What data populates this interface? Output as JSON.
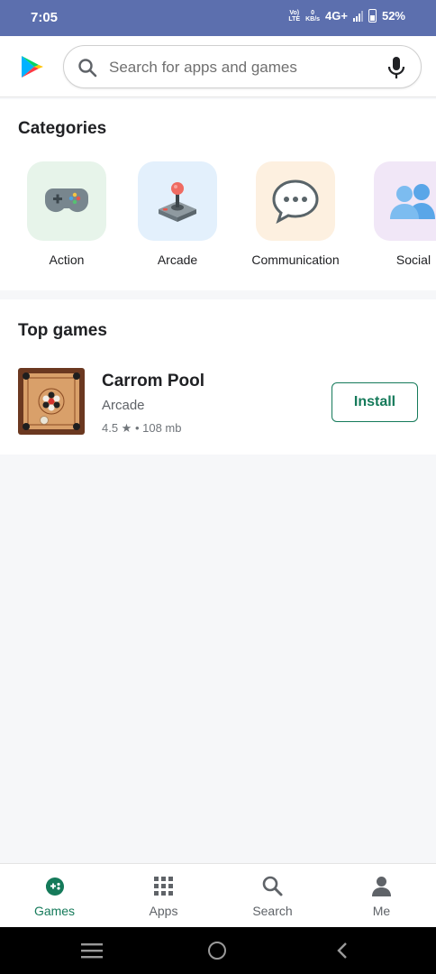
{
  "status_bar": {
    "time": "7:05",
    "volte_top": "Vo)",
    "volte_bottom": "LTE",
    "speed_value": "0",
    "speed_unit": "KB/s",
    "network": "4G+",
    "battery": "52%"
  },
  "search": {
    "placeholder": "Search for apps and games"
  },
  "categories": {
    "title": "Categories",
    "items": [
      {
        "label": "Action",
        "icon": "gamepad-icon",
        "bg": "#e7f4ea"
      },
      {
        "label": "Arcade",
        "icon": "joystick-icon",
        "bg": "#e3f0fc"
      },
      {
        "label": "Communication",
        "icon": "speech-bubble-icon",
        "bg": "#fdf0e0"
      },
      {
        "label": "Social",
        "icon": "people-icon",
        "bg": "#f1e7f7"
      }
    ]
  },
  "top_games": {
    "title": "Top games",
    "items": [
      {
        "name": "Carrom Pool",
        "category": "Arcade",
        "meta": "4.5 ★ • 108 mb",
        "install_label": "Install"
      }
    ]
  },
  "bottom_nav": {
    "items": [
      {
        "label": "Games",
        "icon": "games-icon",
        "active": true
      },
      {
        "label": "Apps",
        "icon": "apps-grid-icon",
        "active": false
      },
      {
        "label": "Search",
        "icon": "search-icon",
        "active": false
      },
      {
        "label": "Me",
        "icon": "person-icon",
        "active": false
      }
    ]
  },
  "colors": {
    "status_bar": "#5c6fae",
    "accent": "#157a5a",
    "background": "#f6f7f9"
  }
}
